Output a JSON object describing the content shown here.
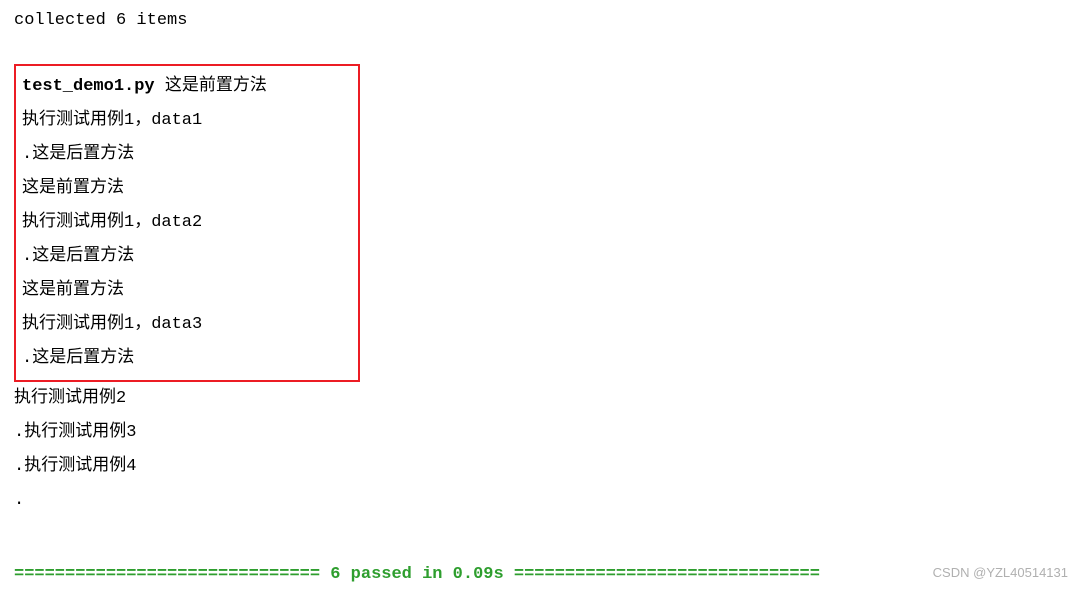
{
  "header": "collected 6 items",
  "redbox": {
    "file_label": "test_demo1.py",
    "setup_after_file": " 这是前置方法",
    "lines": [
      "执行测试用例1，data1",
      ".这是后置方法",
      "这是前置方法",
      "执行测试用例1，data2",
      ".这是后置方法",
      "这是前置方法",
      "执行测试用例1，data3",
      ".这是后置方法"
    ]
  },
  "after_lines": [
    "执行测试用例2",
    ".执行测试用例3",
    ".执行测试用例4",
    "."
  ],
  "summary": {
    "left_deco": "============================== ",
    "center": "6 passed in 0.09s",
    "right_deco": " =============================="
  },
  "watermark": "CSDN @YZL40514131"
}
